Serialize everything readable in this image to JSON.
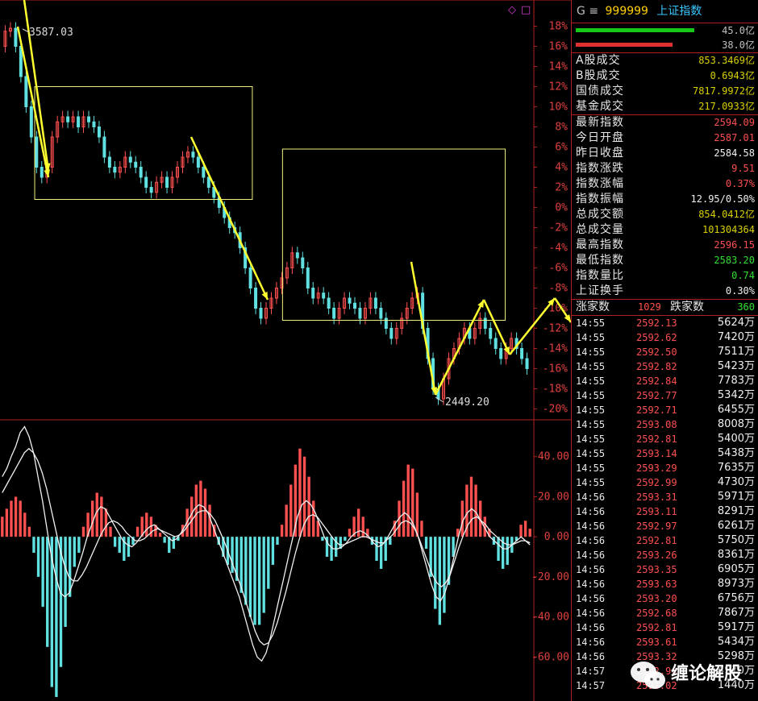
{
  "top_icons": {
    "diamond": "◇",
    "square": "□"
  },
  "chart_data": [
    {
      "type": "candlestick",
      "title": "",
      "y_axis_labels": [
        "18%",
        "16%",
        "14%",
        "12%",
        "10%",
        "8%",
        "6%",
        "4%",
        "2%",
        "0%",
        "-2%",
        "-4%",
        "-6%",
        "-8%",
        "-10%",
        "-12%",
        "-14%",
        "-16%",
        "-18%",
        "-20%"
      ],
      "ylim": [
        -21,
        19
      ],
      "annotations": [
        "3587.03",
        "2449.20"
      ],
      "price_path_pct": [
        16,
        17.5,
        17.8,
        16,
        13,
        10,
        7,
        4,
        3,
        4,
        7,
        8.5,
        9,
        8.5,
        9,
        8,
        9,
        8.5,
        8,
        7,
        5,
        4,
        3.5,
        4,
        5,
        4.5,
        4,
        3,
        2,
        1.5,
        2.5,
        3,
        2,
        3,
        4,
        5,
        5.5,
        5,
        4,
        3,
        2,
        1,
        0,
        -1,
        -2,
        -2.5,
        -4,
        -6,
        -8,
        -10,
        -11,
        -10,
        -9,
        -8,
        -7,
        -6,
        -4.5,
        -5,
        -6,
        -8,
        -9,
        -8.5,
        -9,
        -10,
        -11,
        -10,
        -9,
        -9.5,
        -10,
        -11,
        -10,
        -9,
        -10,
        -11,
        -12,
        -13,
        -12,
        -11,
        -10,
        -9,
        -8.5,
        -12,
        -15,
        -18,
        -19,
        -17,
        -15,
        -14,
        -13,
        -12,
        -13,
        -12,
        -11,
        -12,
        -13,
        -14,
        -15,
        -14,
        -13,
        -14,
        -15,
        -16
      ]
    },
    {
      "type": "bar+line",
      "title": "",
      "y_axis_labels": [
        "40.00",
        "20.00",
        "0.00",
        "-20.00",
        "-40.00",
        "-60.00"
      ],
      "ylim": [
        -82,
        58
      ],
      "histogram": [
        10,
        14,
        18,
        20,
        18,
        12,
        5,
        -8,
        -20,
        -35,
        -55,
        -75,
        -80,
        -65,
        -45,
        -30,
        -15,
        -8,
        5,
        12,
        18,
        22,
        20,
        14,
        5,
        -5,
        -8,
        -12,
        -10,
        -4,
        5,
        10,
        12,
        10,
        6,
        2,
        -3,
        -8,
        -6,
        -2,
        6,
        14,
        20,
        26,
        28,
        24,
        16,
        6,
        -4,
        -10,
        -14,
        -18,
        -22,
        -28,
        -34,
        -40,
        -44,
        -44,
        -38,
        -26,
        -14,
        -4,
        6,
        16,
        26,
        36,
        44,
        40,
        30,
        18,
        8,
        -2,
        -10,
        -12,
        -10,
        -6,
        -2,
        4,
        10,
        14,
        10,
        4,
        -4,
        -12,
        -16,
        -12,
        -4,
        8,
        18,
        28,
        36,
        34,
        22,
        8,
        -6,
        -20,
        -36,
        -44,
        -38,
        -24,
        -10,
        4,
        18,
        26,
        30,
        26,
        18,
        10,
        4,
        -4,
        -12,
        -16,
        -14,
        -8,
        -2,
        6,
        8,
        4
      ],
      "line_dif": [
        30,
        34,
        40,
        45,
        52,
        55,
        50,
        42,
        30,
        18,
        4,
        -10,
        -20,
        -28,
        -30,
        -28,
        -22,
        -15,
        -8,
        0,
        6,
        12,
        15,
        14,
        10,
        6,
        2,
        -2,
        -4,
        -5,
        -3,
        0,
        3,
        5,
        6,
        4,
        2,
        0,
        -2,
        -1,
        2,
        6,
        10,
        14,
        16,
        15,
        12,
        6,
        0,
        -6,
        -12,
        -18,
        -24,
        -30,
        -38,
        -46,
        -54,
        -60,
        -62,
        -58,
        -50,
        -40,
        -30,
        -20,
        -10,
        0,
        10,
        16,
        18,
        16,
        12,
        6,
        0,
        -4,
        -6,
        -6,
        -5,
        -3,
        0,
        2,
        3,
        2,
        0,
        -3,
        -5,
        -4,
        -1,
        3,
        7,
        10,
        12,
        10,
        6,
        0,
        -8,
        -16,
        -24,
        -30,
        -32,
        -28,
        -20,
        -10,
        0,
        8,
        12,
        14,
        12,
        8,
        4,
        0,
        -2,
        -4,
        -6,
        -6,
        -4,
        -2,
        0,
        -2,
        -4
      ],
      "line_dea": [
        22,
        26,
        30,
        34,
        38,
        42,
        44,
        42,
        38,
        32,
        24,
        14,
        4,
        -6,
        -14,
        -20,
        -22,
        -22,
        -19,
        -15,
        -10,
        -5,
        0,
        4,
        7,
        8,
        7,
        5,
        2,
        0,
        -2,
        -2,
        -1,
        1,
        3,
        4,
        3,
        2,
        1,
        0,
        1,
        3,
        6,
        9,
        12,
        13,
        13,
        11,
        8,
        3,
        -2,
        -8,
        -14,
        -20,
        -26,
        -33,
        -40,
        -47,
        -52,
        -54,
        -53,
        -49,
        -43,
        -35,
        -27,
        -18,
        -9,
        -1,
        6,
        10,
        11,
        10,
        7,
        4,
        1,
        -2,
        -4,
        -4,
        -3,
        -2,
        -1,
        0,
        0,
        -1,
        -2,
        -3,
        -3,
        -1,
        1,
        4,
        7,
        8,
        7,
        4,
        -1,
        -7,
        -13,
        -19,
        -23,
        -25,
        -23,
        -19,
        -12,
        -5,
        1,
        6,
        9,
        10,
        8,
        6,
        3,
        1,
        -1,
        -3,
        -4,
        -4,
        -3,
        -2,
        -2,
        -3
      ]
    }
  ],
  "header": {
    "g": "G",
    "menu": "≡",
    "code": "999999",
    "name": "上证指数"
  },
  "bars": [
    {
      "color": "#18c818",
      "frac": 0.98,
      "label": "45.0亿"
    },
    {
      "color": "#e03030",
      "frac": 0.8,
      "label": "38.0亿"
    }
  ],
  "volumes": [
    {
      "label": "A股成交",
      "value": "853.3469亿",
      "color": "c-y"
    },
    {
      "label": "B股成交",
      "value": "0.6943亿",
      "color": "c-y"
    },
    {
      "label": "国债成交",
      "value": "7817.9972亿",
      "color": "c-y"
    },
    {
      "label": "基金成交",
      "value": "217.0933亿",
      "color": "c-y"
    }
  ],
  "stats": [
    {
      "label": "最新指数",
      "value": "2594.09",
      "color": "c-r"
    },
    {
      "label": "今日开盘",
      "value": "2587.01",
      "color": "c-r"
    },
    {
      "label": "昨日收盘",
      "value": "2584.58",
      "color": "c-w"
    },
    {
      "label": "指数涨跌",
      "value": "9.51",
      "color": "c-r"
    },
    {
      "label": "指数涨幅",
      "value": "0.37%",
      "color": "c-r"
    },
    {
      "label": "指数振幅",
      "value": "12.95/0.50%",
      "color": "c-w"
    },
    {
      "label": "总成交额",
      "value": "854.0412亿",
      "color": "c-y"
    },
    {
      "label": "总成交量",
      "value": "101304364",
      "color": "c-y"
    },
    {
      "label": "最高指数",
      "value": "2596.15",
      "color": "c-r"
    },
    {
      "label": "最低指数",
      "value": "2583.20",
      "color": "c-g"
    },
    {
      "label": "指数量比",
      "value": "0.74",
      "color": "c-g"
    },
    {
      "label": "上证换手",
      "value": "0.30%",
      "color": "c-w"
    }
  ],
  "updown": {
    "up_label": "涨家数",
    "up_value": "1029",
    "down_label": "跌家数",
    "down_value": "360"
  },
  "ticks": [
    {
      "time": "14:55",
      "price": "2592.13",
      "vol": "5624万"
    },
    {
      "time": "14:55",
      "price": "2592.62",
      "vol": "7420万"
    },
    {
      "time": "14:55",
      "price": "2592.50",
      "vol": "7511万"
    },
    {
      "time": "14:55",
      "price": "2592.82",
      "vol": "5423万"
    },
    {
      "time": "14:55",
      "price": "2592.84",
      "vol": "7783万"
    },
    {
      "time": "14:55",
      "price": "2592.77",
      "vol": "5342万"
    },
    {
      "time": "14:55",
      "price": "2592.71",
      "vol": "6455万"
    },
    {
      "time": "14:55",
      "price": "2593.08",
      "vol": "8008万"
    },
    {
      "time": "14:55",
      "price": "2592.81",
      "vol": "5400万"
    },
    {
      "time": "14:55",
      "price": "2593.14",
      "vol": "5438万"
    },
    {
      "time": "14:55",
      "price": "2593.29",
      "vol": "7635万"
    },
    {
      "time": "14:55",
      "price": "2592.99",
      "vol": "4730万"
    },
    {
      "time": "14:56",
      "price": "2593.31",
      "vol": "5971万"
    },
    {
      "time": "14:56",
      "price": "2593.11",
      "vol": "8291万"
    },
    {
      "time": "14:56",
      "price": "2592.97",
      "vol": "6261万"
    },
    {
      "time": "14:56",
      "price": "2592.81",
      "vol": "5750万"
    },
    {
      "time": "14:56",
      "price": "2593.26",
      "vol": "8361万"
    },
    {
      "time": "14:56",
      "price": "2593.35",
      "vol": "6905万"
    },
    {
      "time": "14:56",
      "price": "2593.63",
      "vol": "8973万"
    },
    {
      "time": "14:56",
      "price": "2593.20",
      "vol": "6756万"
    },
    {
      "time": "14:56",
      "price": "2592.68",
      "vol": "7867万"
    },
    {
      "time": "14:56",
      "price": "2592.81",
      "vol": "5917万"
    },
    {
      "time": "14:56",
      "price": "2593.61",
      "vol": "5434万"
    },
    {
      "time": "14:56",
      "price": "2593.32",
      "vol": "5298万"
    },
    {
      "time": "14:57",
      "price": "2592.94",
      "vol": "4970万"
    },
    {
      "time": "14:57",
      "price": "2593.02",
      "vol": "1440万"
    }
  ],
  "watermark": {
    "text": "缠论解股"
  },
  "colors": {
    "up": "#ff5050",
    "down": "#60e0e0",
    "arrow": "#ffff30",
    "box": "#f0f080",
    "grid": "#b02020"
  }
}
